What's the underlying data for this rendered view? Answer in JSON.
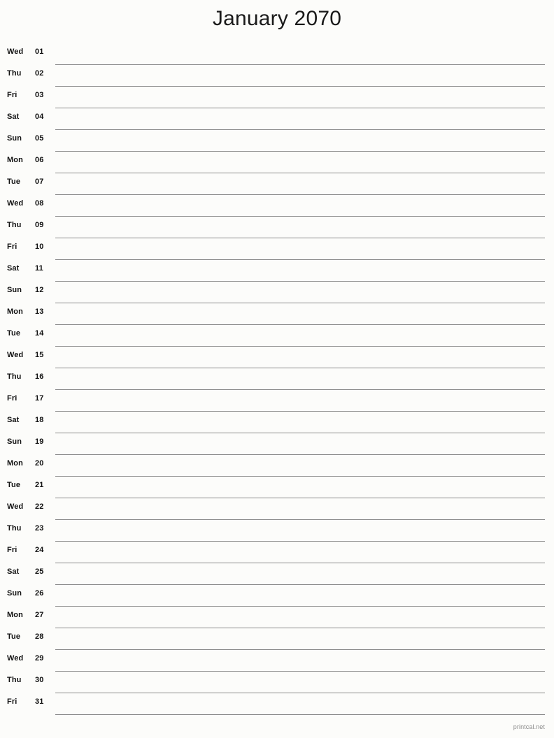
{
  "page": {
    "title": "January 2070",
    "month": "January",
    "year": "2070",
    "background_color": "#fcfcfa",
    "rule_color": "#8a8a8a",
    "text_color": "#111111"
  },
  "footer": {
    "credit": "printcal.net",
    "color": "#8c8c8c"
  },
  "days": [
    {
      "dow": "Wed",
      "num": "01"
    },
    {
      "dow": "Thu",
      "num": "02"
    },
    {
      "dow": "Fri",
      "num": "03"
    },
    {
      "dow": "Sat",
      "num": "04"
    },
    {
      "dow": "Sun",
      "num": "05"
    },
    {
      "dow": "Mon",
      "num": "06"
    },
    {
      "dow": "Tue",
      "num": "07"
    },
    {
      "dow": "Wed",
      "num": "08"
    },
    {
      "dow": "Thu",
      "num": "09"
    },
    {
      "dow": "Fri",
      "num": "10"
    },
    {
      "dow": "Sat",
      "num": "11"
    },
    {
      "dow": "Sun",
      "num": "12"
    },
    {
      "dow": "Mon",
      "num": "13"
    },
    {
      "dow": "Tue",
      "num": "14"
    },
    {
      "dow": "Wed",
      "num": "15"
    },
    {
      "dow": "Thu",
      "num": "16"
    },
    {
      "dow": "Fri",
      "num": "17"
    },
    {
      "dow": "Sat",
      "num": "18"
    },
    {
      "dow": "Sun",
      "num": "19"
    },
    {
      "dow": "Mon",
      "num": "20"
    },
    {
      "dow": "Tue",
      "num": "21"
    },
    {
      "dow": "Wed",
      "num": "22"
    },
    {
      "dow": "Thu",
      "num": "23"
    },
    {
      "dow": "Fri",
      "num": "24"
    },
    {
      "dow": "Sat",
      "num": "25"
    },
    {
      "dow": "Sun",
      "num": "26"
    },
    {
      "dow": "Mon",
      "num": "27"
    },
    {
      "dow": "Tue",
      "num": "28"
    },
    {
      "dow": "Wed",
      "num": "29"
    },
    {
      "dow": "Thu",
      "num": "30"
    },
    {
      "dow": "Fri",
      "num": "31"
    }
  ]
}
